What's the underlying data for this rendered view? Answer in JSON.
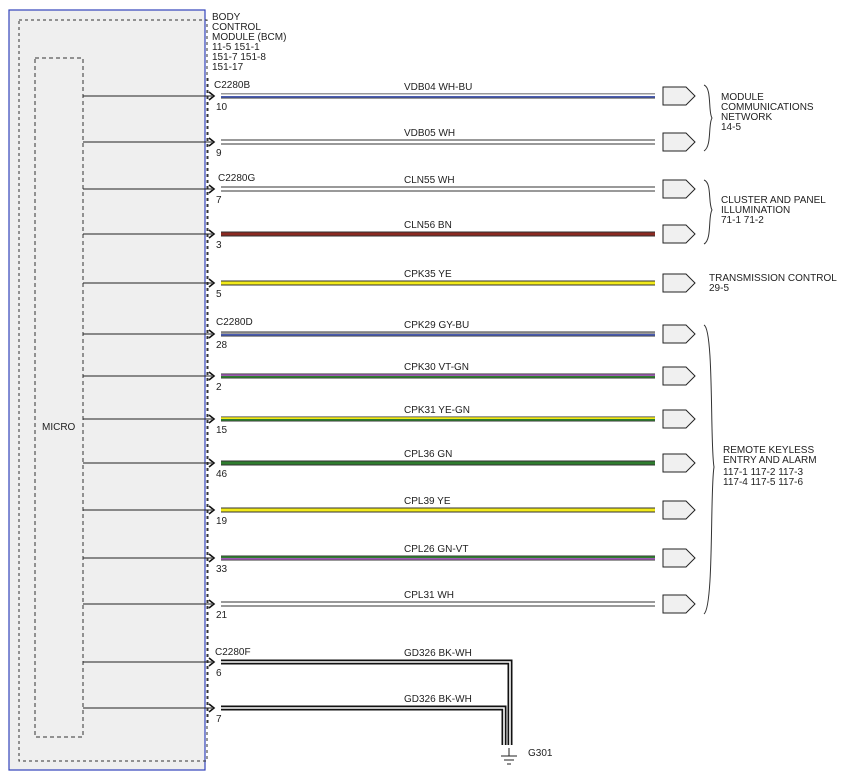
{
  "module": {
    "title_lines": [
      "BODY",
      "CONTROL",
      "MODULE (BCM)",
      "11-5    151-1",
      "151-7  151-8",
      "151-17"
    ],
    "micro_label": "MICRO"
  },
  "connectors": [
    "C2280B",
    "C2280G",
    "C2280D",
    "C2280F"
  ],
  "circuits": [
    {
      "pin": "10",
      "circuit": "VDB04",
      "color_code": "WH-BU",
      "colors": [
        "#ffffff",
        "#4a5cb0"
      ]
    },
    {
      "pin": "9",
      "circuit": "VDB05",
      "color_code": "WH",
      "colors": [
        "#ffffff"
      ]
    },
    {
      "pin": "7",
      "circuit": "CLN55",
      "color_code": "WH",
      "colors": [
        "#ffffff"
      ]
    },
    {
      "pin": "3",
      "circuit": "CLN56",
      "color_code": "BN",
      "colors": [
        "#8b2a22"
      ]
    },
    {
      "pin": "5",
      "circuit": "CPK35",
      "color_code": "YE",
      "colors": [
        "#f2ea1a"
      ]
    },
    {
      "pin": "28",
      "circuit": "CPK29",
      "color_code": "GY-BU",
      "colors": [
        "#9a9a9a",
        "#4a5cb0"
      ]
    },
    {
      "pin": "2",
      "circuit": "CPK30",
      "color_code": "VT-GN",
      "colors": [
        "#9b5bb0",
        "#2f7d2f"
      ]
    },
    {
      "pin": "15",
      "circuit": "CPK31",
      "color_code": "YE-GN",
      "colors": [
        "#f2ea1a",
        "#2f7d2f"
      ]
    },
    {
      "pin": "46",
      "circuit": "CPL36",
      "color_code": "GN",
      "colors": [
        "#2f7d2f"
      ]
    },
    {
      "pin": "19",
      "circuit": "CPL39",
      "color_code": "YE",
      "colors": [
        "#f2ea1a"
      ]
    },
    {
      "pin": "33",
      "circuit": "CPL26",
      "color_code": "GN-VT",
      "colors": [
        "#2f7d2f",
        "#9b5bb0"
      ]
    },
    {
      "pin": "21",
      "circuit": "CPL31",
      "color_code": "WH",
      "colors": [
        "#ffffff"
      ]
    },
    {
      "pin": "6",
      "circuit": "GD326",
      "color_code": "BK-WH",
      "colors": [
        "#111111",
        "#ffffff"
      ]
    },
    {
      "pin": "7",
      "circuit": "GD326",
      "color_code": "BK-WH",
      "colors": [
        "#111111",
        "#ffffff"
      ]
    }
  ],
  "destinations": [
    {
      "lines": [
        "MODULE",
        "COMMUNICATIONS",
        "NETWORK",
        "14-5"
      ]
    },
    {
      "lines": [
        "CLUSTER AND PANEL",
        "ILLUMINATION",
        "71-1     71-2"
      ]
    },
    {
      "lines": [
        "TRANSMISSION CONTROL",
        "29-5"
      ]
    },
    {
      "lines": [
        "REMOTE KEYLESS",
        "ENTRY AND ALARM",
        "117-1   117-2   117-3",
        "117-4   117-5   117-6"
      ]
    }
  ],
  "ground": {
    "label": "G301"
  }
}
